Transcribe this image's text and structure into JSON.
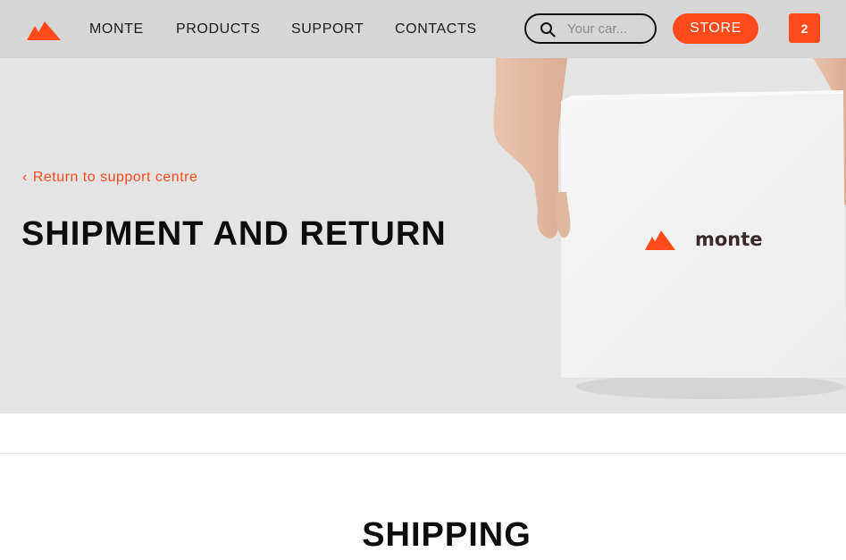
{
  "header": {
    "nav": [
      "MONTE",
      "PRODUCTS",
      "SUPPORT",
      "CONTACTS"
    ],
    "search_placeholder": "Your car...",
    "store_label": "STORE",
    "cart_count": "2"
  },
  "hero": {
    "back_link": "Return to support centre",
    "title": "SHIPMENT AND RETURN",
    "box_brand": "monte"
  },
  "main": {
    "section_title": "SHIPPING"
  },
  "colors": {
    "accent": "#ff4a1c",
    "header_bg": "#d6d6d6",
    "hero_bg": "#e4e4e4"
  }
}
